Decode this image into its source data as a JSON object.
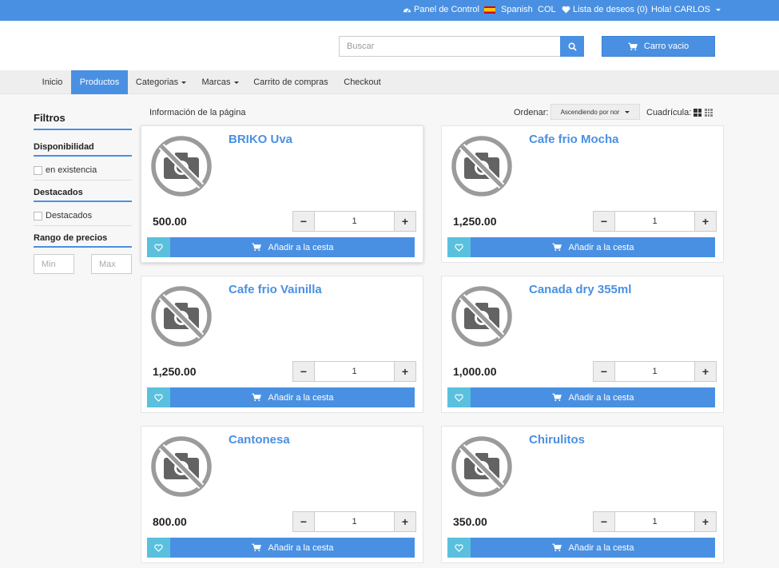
{
  "topbar": {
    "dashboard": "Panel de Control",
    "language": "Spanish",
    "currency": "COL",
    "wishlist": "Lista de deseos (0)",
    "user": "Hola! CARLOS"
  },
  "header": {
    "search_placeholder": "Buscar",
    "cart_label": "Carro vacio"
  },
  "nav": [
    {
      "label": "Inicio"
    },
    {
      "label": "Productos",
      "active": true
    },
    {
      "label": "Categorias",
      "dropdown": true
    },
    {
      "label": "Marcas",
      "dropdown": true
    },
    {
      "label": "Carrito de compras"
    },
    {
      "label": "Checkout"
    }
  ],
  "sidebar": {
    "title": "Filtros",
    "availability_title": "Disponibilidad",
    "availability_option": "en existencia",
    "featured_title": "Destacados",
    "featured_option": "Destacados",
    "price_title": "Rango de precios",
    "min_placeholder": "Min",
    "max_placeholder": "Max"
  },
  "toolbar": {
    "page_info": "Información de la página",
    "sort_label": "Ordenar:",
    "sort_value": "Ascendiendo por nor",
    "grid_label": "Cuadrícula:"
  },
  "products": [
    {
      "name": "BRIKO Uva",
      "price": "500.00",
      "qty": "1"
    },
    {
      "name": "Cafe frio Mocha",
      "price": "1,250.00",
      "qty": "1"
    },
    {
      "name": "Cafe frio Vainilla",
      "price": "1,250.00",
      "qty": "1"
    },
    {
      "name": "Canada dry 355ml",
      "price": "1,000.00",
      "qty": "1"
    },
    {
      "name": "Cantonesa",
      "price": "800.00",
      "qty": "1"
    },
    {
      "name": "Chirulitos",
      "price": "350.00",
      "qty": "1"
    }
  ],
  "card_labels": {
    "add_to_cart": "Añadir a la cesta",
    "minus": "−",
    "plus": "+"
  },
  "icons": {
    "dashboard": "dashboard-icon",
    "wishlist": "heart-icon",
    "search": "search-icon",
    "cart": "cart-icon",
    "no_image": "no-camera-icon"
  },
  "colors": {
    "primary": "#4a90e2",
    "wishlist_button": "#5bc0de",
    "background": "#f7f7f7"
  }
}
